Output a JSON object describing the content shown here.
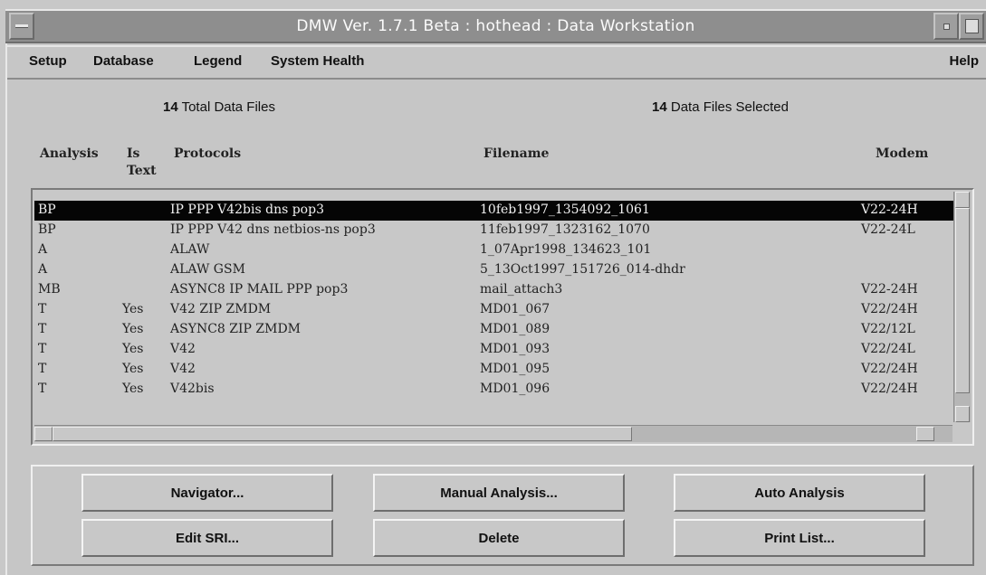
{
  "window": {
    "title": "DMW Ver. 1.7.1 Beta : hothead : Data Workstation"
  },
  "menubar": {
    "items": [
      "Setup",
      "Database",
      "Legend",
      "System Health"
    ],
    "help": "Help"
  },
  "summary": {
    "total_count": "14",
    "total_label": "Total Data Files",
    "selected_count": "14",
    "selected_label": "Data Files Selected"
  },
  "columns": {
    "analysis": "Analysis",
    "is_text_1": "Is",
    "is_text_2": "Text",
    "protocols": "Protocols",
    "filename": "Filename",
    "modem": "Modem"
  },
  "rows": [
    {
      "analysis": "BP",
      "is_text": "",
      "protocols": "IP PPP V42bis dns pop3",
      "filename": "10feb1997_1354092_1061",
      "modem": "V22-24H",
      "selected": true
    },
    {
      "analysis": "BP",
      "is_text": "",
      "protocols": "IP PPP V42 dns netbios-ns pop3",
      "filename": "11feb1997_1323162_1070",
      "modem": "V22-24L",
      "selected": false
    },
    {
      "analysis": "A",
      "is_text": "",
      "protocols": "ALAW",
      "filename": "1_07Apr1998_134623_101",
      "modem": "",
      "selected": false
    },
    {
      "analysis": "A",
      "is_text": "",
      "protocols": "ALAW GSM",
      "filename": "5_13Oct1997_151726_014-dhdr",
      "modem": "",
      "selected": false
    },
    {
      "analysis": "MB",
      "is_text": "",
      "protocols": "ASYNC8 IP MAIL PPP pop3",
      "filename": "mail_attach3",
      "modem": "V22-24H",
      "selected": false
    },
    {
      "analysis": "T",
      "is_text": "Yes",
      "protocols": "V42 ZIP ZMDM",
      "filename": "MD01_067",
      "modem": "V22/24H",
      "selected": false
    },
    {
      "analysis": "T",
      "is_text": "Yes",
      "protocols": "ASYNC8 ZIP ZMDM",
      "filename": "MD01_089",
      "modem": "V22/12L",
      "selected": false
    },
    {
      "analysis": "T",
      "is_text": "Yes",
      "protocols": "V42",
      "filename": "MD01_093",
      "modem": "V22/24L",
      "selected": false
    },
    {
      "analysis": "T",
      "is_text": "Yes",
      "protocols": "V42",
      "filename": "MD01_095",
      "modem": "V22/24H",
      "selected": false
    },
    {
      "analysis": "T",
      "is_text": "Yes",
      "protocols": "V42bis",
      "filename": "MD01_096",
      "modem": "V22/24H",
      "selected": false
    }
  ],
  "buttons": {
    "navigator": "Navigator...",
    "manual_analysis": "Manual Analysis...",
    "auto_analysis": "Auto Analysis",
    "edit_sri": "Edit SRI...",
    "delete": "Delete",
    "print_list": "Print List..."
  },
  "icons": {
    "window_menu": "window-menu-icon",
    "minimize": "minimize-icon",
    "maximize": "maximize-icon"
  }
}
